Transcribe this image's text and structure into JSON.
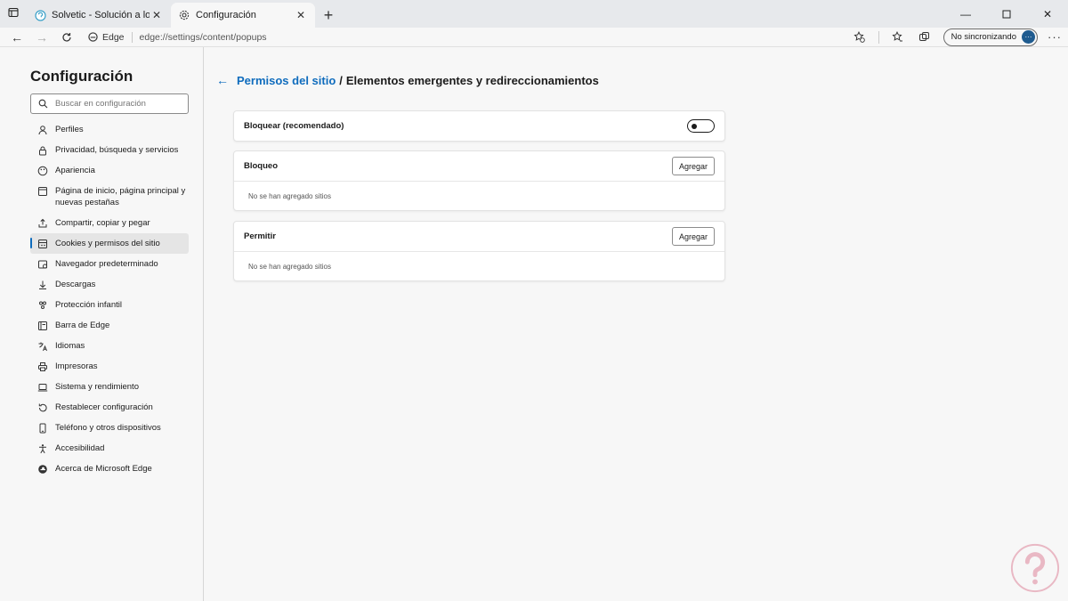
{
  "browser": {
    "tabs": [
      {
        "title": "Solvetic - Solución a los problemas",
        "active": false
      },
      {
        "title": "Configuración",
        "active": true
      }
    ],
    "chip_label": "Edge",
    "url": "edge://settings/content/popups",
    "sync_label": "No sincronizando",
    "avatar_label": "···"
  },
  "sidebar": {
    "title": "Configuración",
    "search_placeholder": "Buscar en configuración",
    "items": [
      {
        "label": "Perfiles",
        "icon": "profile-icon"
      },
      {
        "label": "Privacidad, búsqueda y servicios",
        "icon": "lock-icon"
      },
      {
        "label": "Apariencia",
        "icon": "palette-icon"
      },
      {
        "label": "Página de inicio, página principal y nuevas pestañas",
        "icon": "home-page-icon"
      },
      {
        "label": "Compartir, copiar y pegar",
        "icon": "share-icon"
      },
      {
        "label": "Cookies y permisos del sitio",
        "icon": "cookies-icon",
        "selected": true
      },
      {
        "label": "Navegador predeterminado",
        "icon": "browser-icon"
      },
      {
        "label": "Descargas",
        "icon": "download-icon"
      },
      {
        "label": "Protección infantil",
        "icon": "family-icon"
      },
      {
        "label": "Barra de Edge",
        "icon": "edge-bar-icon"
      },
      {
        "label": "Idiomas",
        "icon": "language-icon"
      },
      {
        "label": "Impresoras",
        "icon": "printer-icon"
      },
      {
        "label": "Sistema y rendimiento",
        "icon": "laptop-icon"
      },
      {
        "label": "Restablecer configuración",
        "icon": "reset-icon"
      },
      {
        "label": "Teléfono y otros dispositivos",
        "icon": "phone-icon"
      },
      {
        "label": "Accesibilidad",
        "icon": "accessibility-icon"
      },
      {
        "label": "Acerca de Microsoft Edge",
        "icon": "edge-logo-icon"
      }
    ]
  },
  "main": {
    "breadcrumb_link": "Permisos del sitio",
    "breadcrumb_sep": "/",
    "breadcrumb_current": "Elementos emergentes y redireccionamientos",
    "block_label": "Bloquear (recomendado)",
    "block_on": false,
    "bloqueo": {
      "label": "Bloqueo",
      "button": "Agregar",
      "empty": "No se han agregado sitios"
    },
    "permitir": {
      "label": "Permitir",
      "button": "Agregar",
      "empty": "No se han agregado sitios"
    }
  },
  "colors": {
    "accent": "#0f6cbd",
    "watermark": "#e9b8c4"
  }
}
